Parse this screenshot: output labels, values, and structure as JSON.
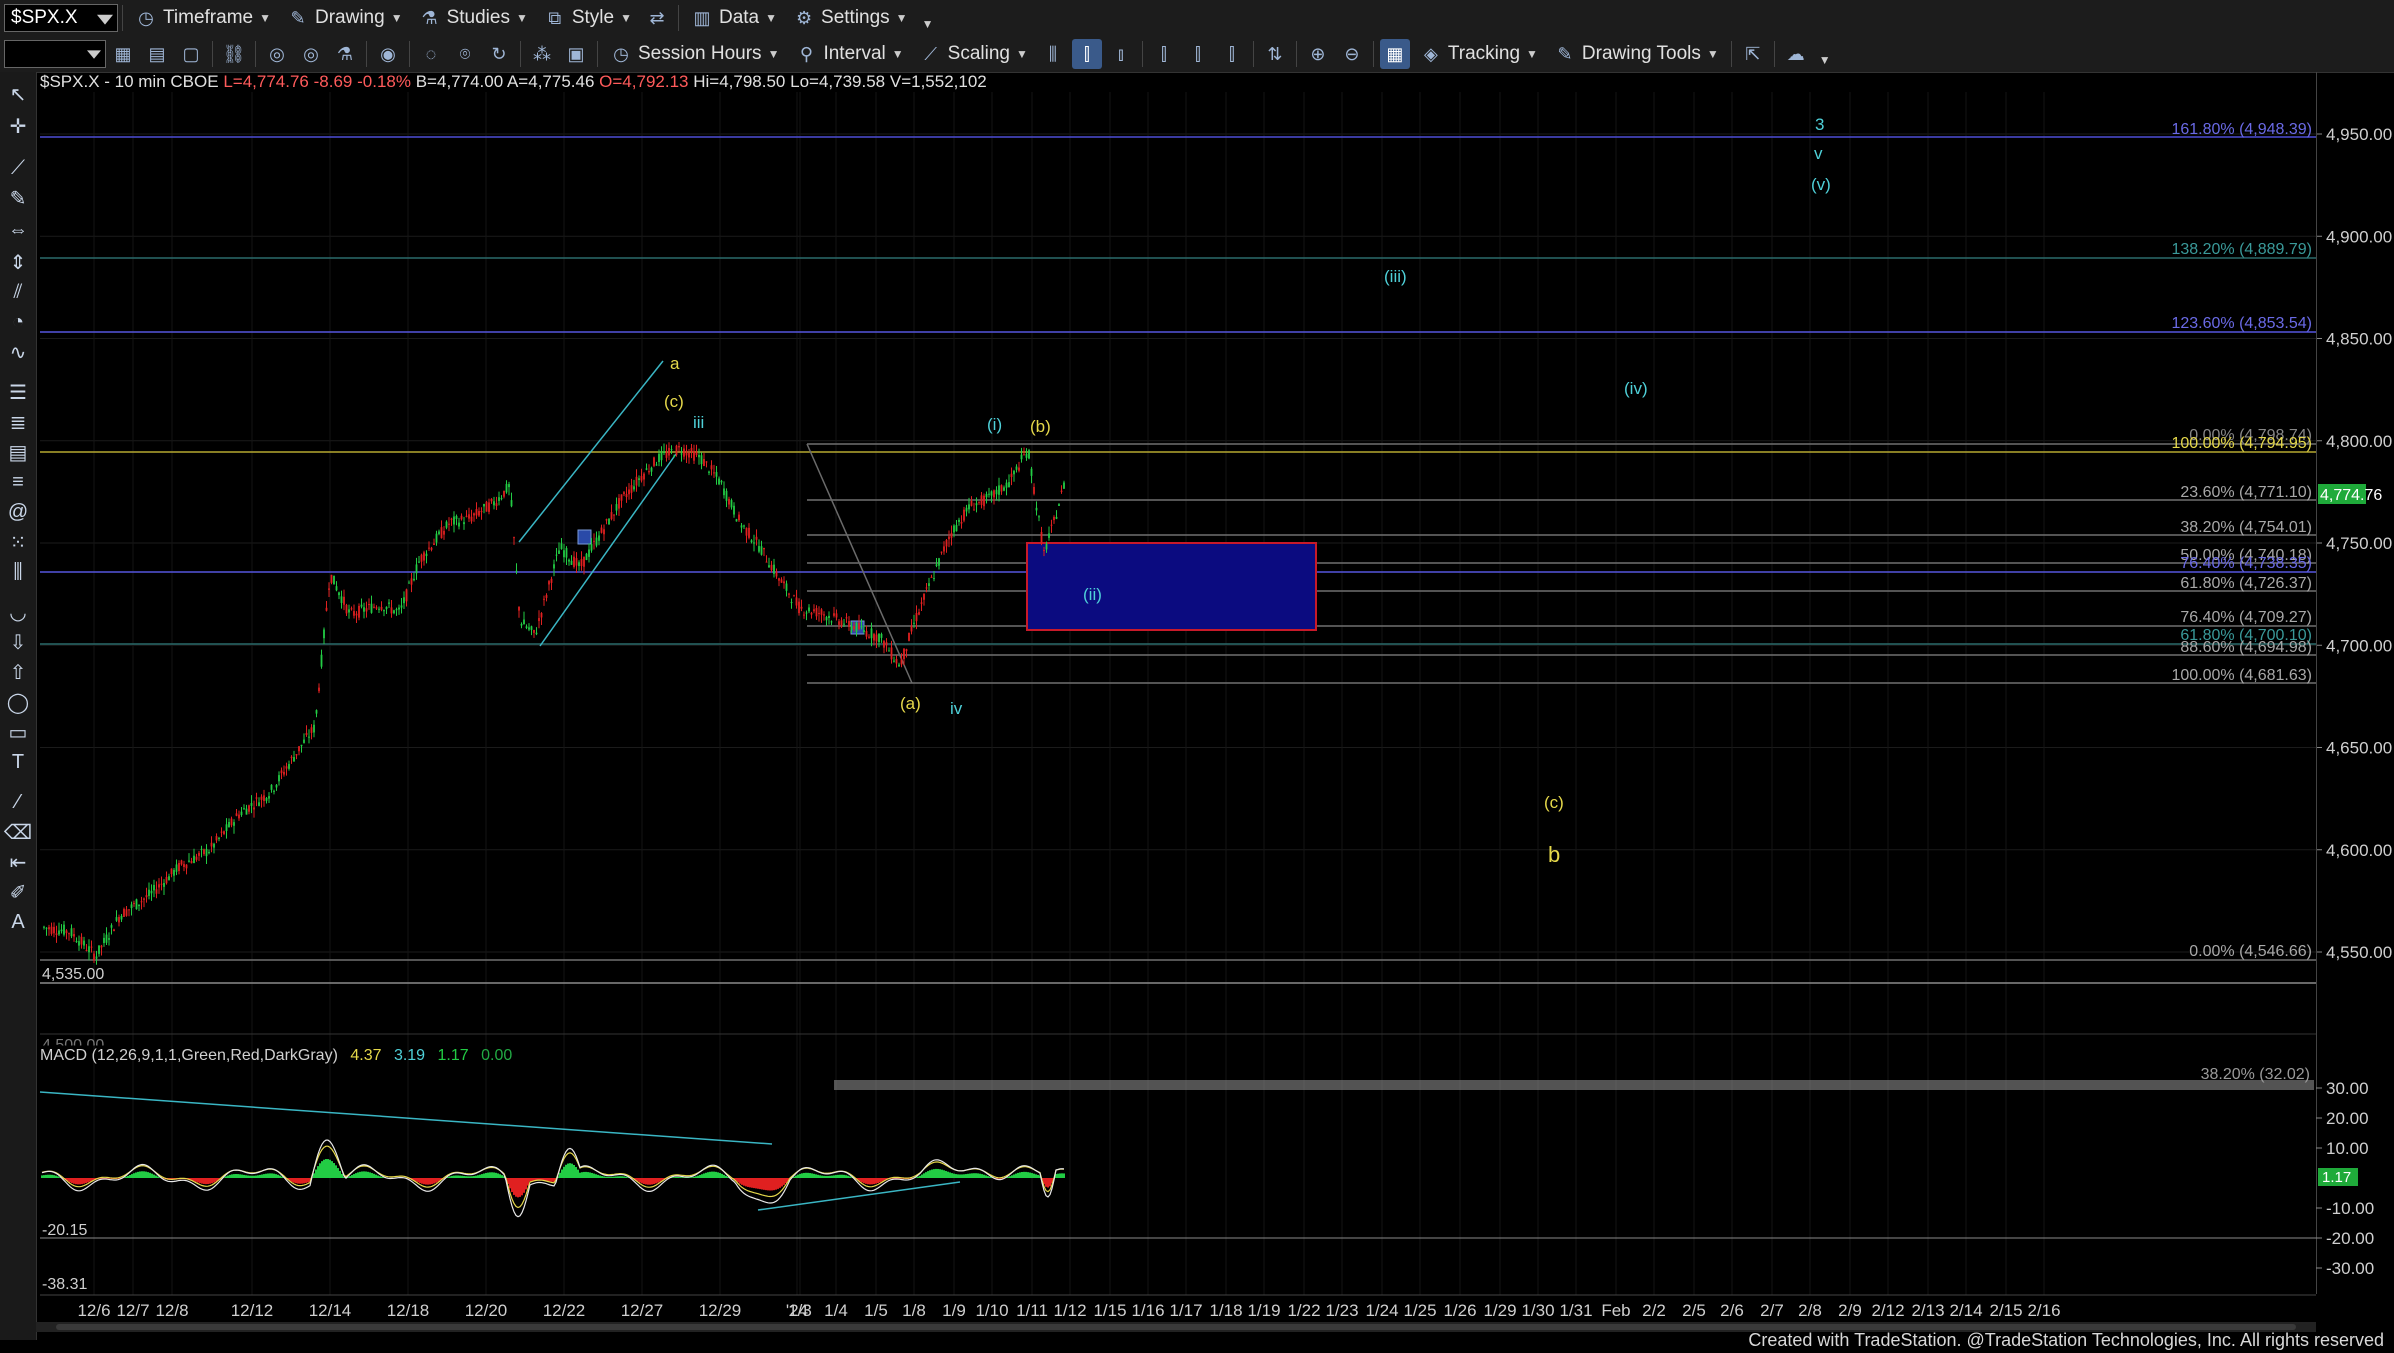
{
  "toolbar1": {
    "symbol": "$SPX.X",
    "timeframe": "Timeframe",
    "drawing": "Drawing",
    "studies": "Studies",
    "style": "Style",
    "data": "Data",
    "settings": "Settings"
  },
  "toolbar2": {
    "session_hours": "Session Hours",
    "interval": "Interval",
    "scaling": "Scaling",
    "tracking": "Tracking",
    "drawing_tools": "Drawing Tools"
  },
  "info": {
    "symbol_interval": "$SPX.X - 10 min",
    "exchange": "CBOE",
    "last": "L=4,774.76",
    "change": "-8.69",
    "change_pct": "-0.18%",
    "bid": "B=4,774.00",
    "ask": "A=4,775.46",
    "open": "O=4,792.13",
    "high": "Hi=4,798.50",
    "low": "Lo=4,739.58",
    "volume": "V=1,552,102"
  },
  "macd": {
    "label": "MACD (12,26,9,1,1,Green,Red,DarkGray)",
    "v1": "4.37",
    "v2": "3.19",
    "v3": "1.17",
    "v4": "0.00",
    "label_left_1": "-20.15",
    "label_left_2": "-38.31",
    "axis": [
      "30.00",
      "20.00",
      "10.00",
      "-10.00",
      "-20.00",
      "-30.00"
    ],
    "last_tag": "1.17"
  },
  "price_axis": [
    "4,950.00",
    "4,900.00",
    "4,850.00",
    "4,800.00",
    "4,750.00",
    "4,700.00",
    "4,650.00",
    "4,600.00",
    "4,550.00"
  ],
  "last_price_tag": "4,774.76",
  "low_label": "4,535.00",
  "low_label2": "4,500.00",
  "date_axis": [
    "12/6",
    "12/7",
    "12/8",
    "12/12",
    "12/14",
    "12/18",
    "12/20",
    "12/22",
    "12/27",
    "12/29",
    "'24",
    "1/3",
    "1/4",
    "1/5",
    "1/8",
    "1/9",
    "1/10",
    "1/11",
    "1/12",
    "1/15",
    "1/16",
    "1/17",
    "1/18",
    "1/19",
    "1/22",
    "1/23",
    "1/24",
    "1/25",
    "1/26",
    "1/29",
    "1/30",
    "1/31",
    "Feb",
    "2/2",
    "2/5",
    "2/6",
    "2/7",
    "2/8",
    "2/9",
    "2/12",
    "2/13",
    "2/14",
    "2/15",
    "2/16"
  ],
  "fib_labels": {
    "f1618": "161.80% (4,948.39)",
    "f1382": "138.20% (4,889.79)",
    "f1236": "123.60% (4,853.54)",
    "f0": "0.00% (4,798.74)",
    "f100": "100.00% (4,794.95)",
    "f236": "23.60% (4,771.10)",
    "f382": "38.20% (4,754.01)",
    "f50": "50.00% (4,740.18)",
    "f764a": "76.40% (4,738.35)",
    "f618": "61.80% (4,726.37)",
    "f764": "76.40% (4,709.27)",
    "f618b": "61.80% (4,700.10)",
    "f886": "88.60% (4,694.98)",
    "f1000": "100.00% (4,681.63)",
    "f00": "0.00% (4,546.66)",
    "macd_fib": "38.20% (32.02)"
  },
  "wave_labels": {
    "a": "a",
    "c_paren": "(c)",
    "iii": "iii",
    "i_paren": "(i)",
    "b_paren": "(b)",
    "a_paren": "(a)",
    "iv": "iv",
    "ii_paren": "(ii)",
    "iii_paren": "(iii)",
    "iv_paren": "(iv)",
    "three": "3",
    "v": "v",
    "v_paren": "(v)",
    "c_paren_2": "(c)",
    "b": "b"
  },
  "colors": {
    "yellow": "#e5d84a",
    "cyan": "#4fd1d9",
    "fib_blue": "#3b3bcc",
    "box_fill": "#1a1a8c",
    "box_border": "#d02030",
    "candle_up": "#22cc44",
    "candle_down": "#e02020"
  },
  "footer": "Created with TradeStation. @TradeStation Technologies, Inc. All rights reserved"
}
